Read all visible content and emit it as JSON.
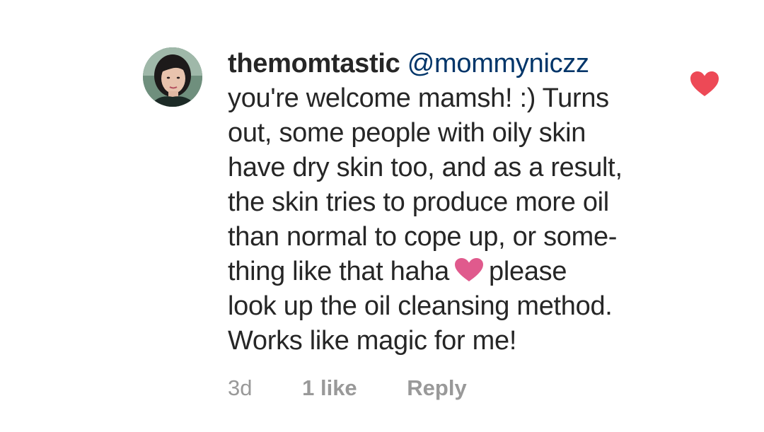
{
  "comment": {
    "username": "themomtastic",
    "mention": "@mommyniczz",
    "lines": [
      "you're welcome mamsh! :) Turns",
      "out, some people with oily skin",
      "have dry skin too, and as a result,",
      "the skin tries to produce more oil",
      "than normal to cope up, or some-",
      "thing like that haha",
      "please",
      "look up the oil cleansing method.",
      "Works like magic for me!"
    ],
    "inline_emoji": "pink-heart-icon",
    "time": "3d",
    "likes": "1 like",
    "reply_label": "Reply",
    "liked": true
  },
  "colors": {
    "text": "#262626",
    "mention": "#003569",
    "meta": "#999999",
    "like_heart": "#ed4956",
    "emoji_heart": "#e05a8d"
  },
  "icons": {
    "like": "heart-icon",
    "avatar": "avatar"
  }
}
